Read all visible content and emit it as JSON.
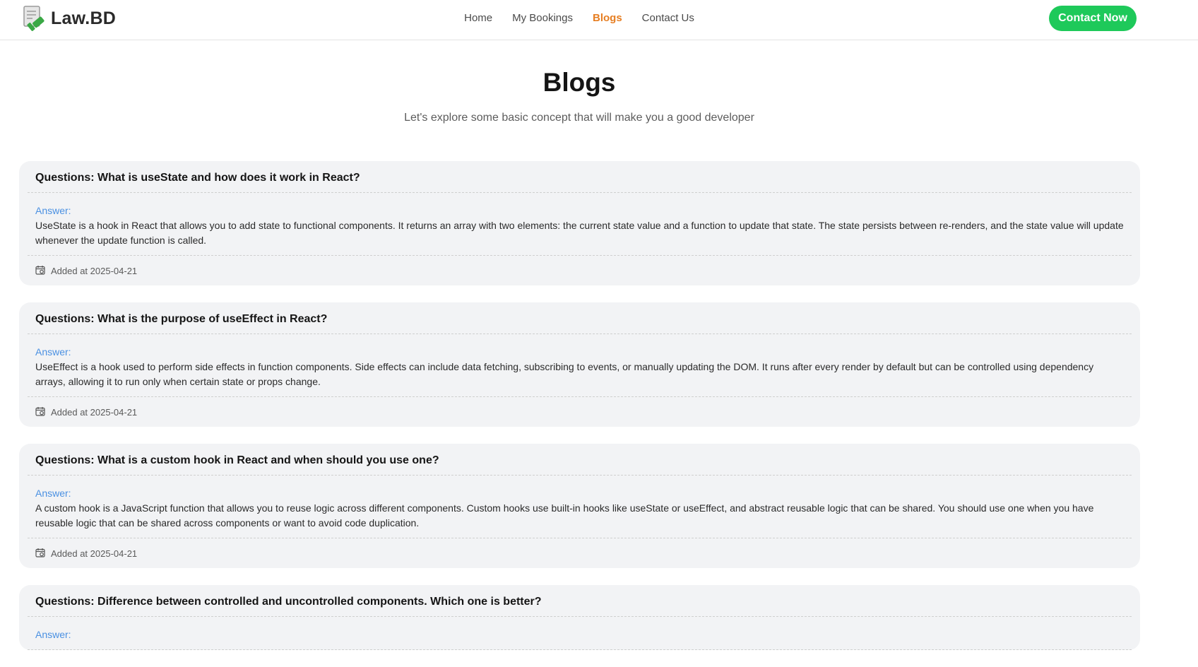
{
  "brand": {
    "name": "Law.BD",
    "logo_icon": "law-logo-icon",
    "logo_color": "#3aa845"
  },
  "nav": {
    "links": [
      "Home",
      "My Bookings",
      "Blogs",
      "Contact Us"
    ],
    "active": "Blogs",
    "active_color": "#e67e22",
    "cta_label": "Contact Now",
    "cta_color": "#1ec95a"
  },
  "hero": {
    "title": "Blogs",
    "subtitle": "Let's explore some basic concept that will make you a good developer"
  },
  "posts": [
    {
      "question": "Questions: What is useState and how does it work in React?",
      "answer_label": "Answer:",
      "answer": "UseState is a hook in React that allows you to add state to functional components. It returns an array with two elements: the current state value and a function to update that state. The state persists between re-renders, and the state value will update whenever the update function is called.",
      "added": "Added at 2025-04-21"
    },
    {
      "question": "Questions: What is the purpose of useEffect in React?",
      "answer_label": "Answer:",
      "answer": "UseEffect is a hook used to perform side effects in function components. Side effects can include data fetching, subscribing to events, or manually updating the DOM. It runs after every render by default but can be controlled using dependency arrays, allowing it to run only when certain state or props change.",
      "added": "Added at 2025-04-21"
    },
    {
      "question": "Questions: What is a custom hook in React and when should you use one?",
      "answer_label": "Answer:",
      "answer": "A custom hook is a JavaScript function that allows you to reuse logic across different components. Custom hooks use built-in hooks like useState or useEffect, and abstract reusable logic that can be shared. You should use one when you have reusable logic that can be shared across components or want to avoid code duplication.",
      "added": "Added at 2025-04-21"
    },
    {
      "question": "Questions: Difference between controlled and uncontrolled components. Which one is better?",
      "answer_label": "Answer:",
      "answer": "",
      "added": ""
    }
  ]
}
